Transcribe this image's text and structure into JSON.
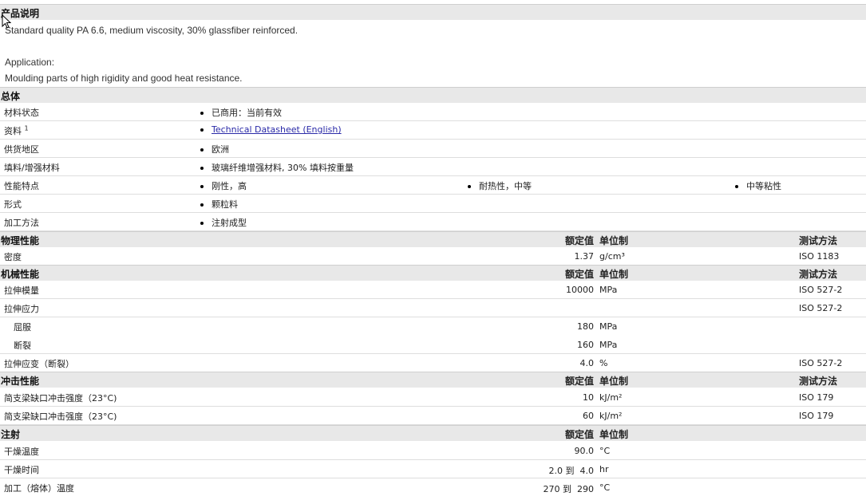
{
  "product_description": {
    "title": "产品说明",
    "text": "Standard quality PA 6.6, medium viscosity, 30% glassfiber reinforced.",
    "application_label": "Application:",
    "application_text": "Moulding parts of high rigidity and good heat resistance."
  },
  "general": {
    "title": "总体",
    "rows": [
      {
        "label": "材料状态",
        "values": [
          "已商用：当前有效"
        ]
      },
      {
        "label": "资料",
        "sup": "1",
        "values": [
          "Technical Datasheet (English)"
        ]
      },
      {
        "label": "供货地区",
        "values": [
          "欧洲"
        ]
      },
      {
        "label": "填料/增强材料",
        "values": [
          "玻璃纤维增强材料, 30% 填料按重量"
        ]
      },
      {
        "label": "性能特点",
        "values": [
          "刚性，高",
          "耐热性，中等",
          "中等粘性"
        ]
      },
      {
        "label": "形式",
        "values": [
          "颗粒料"
        ]
      },
      {
        "label": "加工方法",
        "values": [
          "注射成型"
        ]
      }
    ]
  },
  "columns": {
    "nominal": "额定值",
    "unit": "单位制",
    "method": "测试方法"
  },
  "physical": {
    "title": "物理性能",
    "rows": [
      {
        "label": "密度",
        "value": "1.37",
        "unit": "g/cm³",
        "method": "ISO 1183"
      }
    ]
  },
  "mechanical": {
    "title": "机械性能",
    "rows": [
      {
        "label": "拉伸模量",
        "value": "10000",
        "unit": "MPa",
        "method": "ISO 527-2"
      },
      {
        "label": "拉伸应力",
        "value": "",
        "unit": "",
        "method": "ISO 527-2"
      },
      {
        "label": "屈服",
        "value": "180",
        "unit": "MPa",
        "method": ""
      },
      {
        "label": "断裂",
        "value": "160",
        "unit": "MPa",
        "method": ""
      },
      {
        "label": "拉伸应变（断裂）",
        "value": "4.0",
        "unit": "%",
        "method": "ISO 527-2"
      }
    ]
  },
  "impact": {
    "title": "冲击性能",
    "rows": [
      {
        "label": "简支梁缺口冲击强度（23°C)",
        "value": "10",
        "unit": "kJ/m²",
        "method": "ISO 179"
      },
      {
        "label": "简支梁缺口冲击强度（23°C)",
        "value": "60",
        "unit": "kJ/m²",
        "method": "ISO 179"
      }
    ]
  },
  "injection": {
    "title": "注射",
    "rows": [
      {
        "label": "干燥温度",
        "value": "90.0",
        "unit": "°C",
        "method": ""
      },
      {
        "label": "干燥时间",
        "value": "2.0 到  4.0",
        "unit": "hr",
        "method": ""
      },
      {
        "label": "加工（熔体）温度",
        "value": "270 到  290",
        "unit": "°C",
        "method": ""
      }
    ]
  },
  "colors": {
    "header_bg": "#e8e8e8",
    "link": "#2a2aa8"
  }
}
